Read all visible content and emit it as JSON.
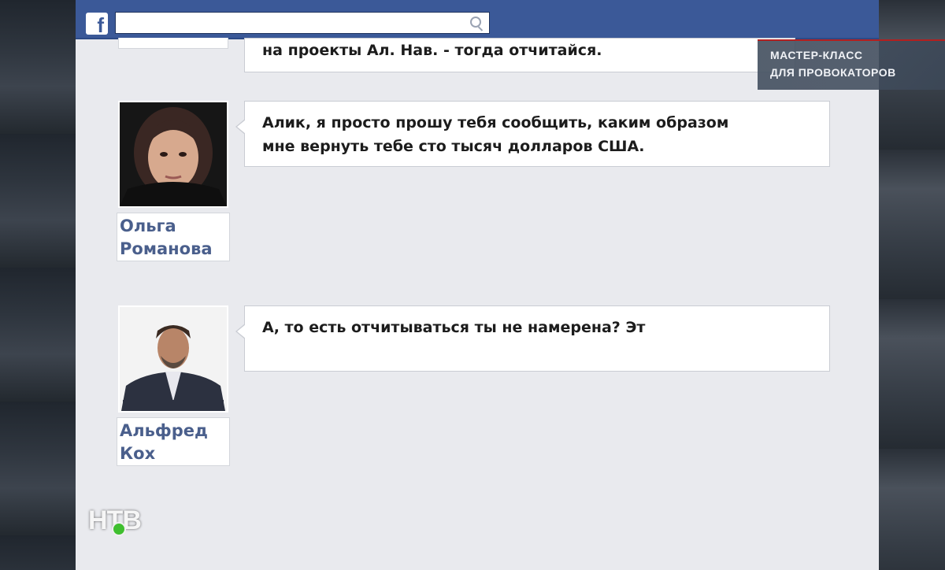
{
  "facebook": {
    "logo": "f",
    "search": {
      "value": "",
      "placeholder": ""
    }
  },
  "messages": [
    {
      "text": "на проекты Ал. Нав. - тогда отчитайся."
    },
    {
      "author": {
        "first": "Ольга",
        "last": "Романова"
      },
      "text": "Алик, я просто прошу тебя сообщить, каким образом\nмне вернуть тебе сто тысяч долларов США."
    },
    {
      "author": {
        "first": "Альфред",
        "last": "Кох"
      },
      "text": "А, то есть отчитываться ты не намерена? Эт"
    }
  ],
  "overlay": {
    "line1": "МАСТЕР-КЛАСС",
    "line2": "ДЛЯ ПРОВОКАТОРОВ"
  },
  "channel_logo": "НТВ",
  "colors": {
    "facebook_blue": "#3b5998",
    "name_blue": "#4a5f8c",
    "ntv_green": "#3fbf2f"
  }
}
